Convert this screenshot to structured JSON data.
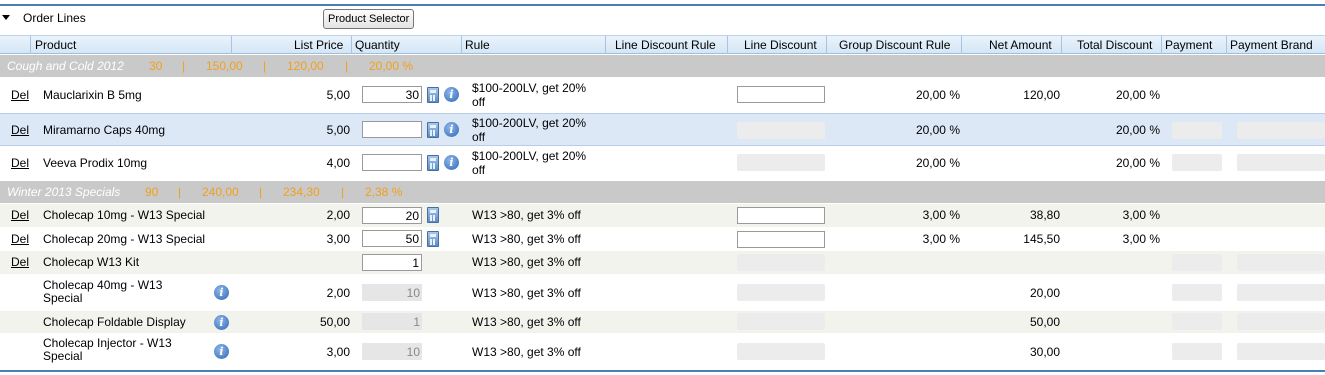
{
  "section": {
    "title": "Order Lines",
    "product_selector_label": "Product Selector"
  },
  "columns": [
    "Product",
    "List Price",
    "Quantity",
    "Rule",
    "Line Discount Rule",
    "Line Discount",
    "Group Discount Rule",
    "Net Amount",
    "Total Discount",
    "Payment",
    "Payment Brand"
  ],
  "groups": [
    {
      "name": "Cough and Cold 2012",
      "qty": "30",
      "amount": "150,00",
      "net": "120,00",
      "disc": "20,00 %"
    },
    {
      "name": "Winter 2013 Specials",
      "qty": "90",
      "amount": "240,00",
      "net": "234,30",
      "disc": "2,38 %"
    }
  ],
  "separator": "|",
  "del_label": "Del",
  "info_glyph": "i",
  "rows": [
    {
      "product": "Mauclarixin B 5mg",
      "price": "5,00",
      "qty": "30",
      "rule": "$100-200LV, get 20% off",
      "group_discount": "20,00 %",
      "net": "120,00",
      "total_discount": "20,00 %"
    },
    {
      "product": "Miramarno Caps 40mg",
      "price": "5,00",
      "qty": "",
      "rule": "$100-200LV, get 20% off",
      "group_discount": "20,00 %",
      "net": "",
      "total_discount": "20,00 %"
    },
    {
      "product": "Veeva Prodix 10mg",
      "price": "4,00",
      "qty": "",
      "rule": "$100-200LV, get 20% off",
      "group_discount": "20,00 %",
      "net": "",
      "total_discount": "20,00 %"
    },
    {
      "product": "Cholecap 10mg - W13 Special",
      "price": "2,00",
      "qty": "20",
      "rule": "W13 >80, get 3% off",
      "group_discount": "3,00 %",
      "net": "38,80",
      "total_discount": "3,00 %"
    },
    {
      "product": "Cholecap 20mg - W13 Special",
      "price": "3,00",
      "qty": "50",
      "rule": "W13 >80, get 3% off",
      "group_discount": "3,00 %",
      "net": "145,50",
      "total_discount": "3,00 %"
    },
    {
      "product": "Cholecap W13 Kit",
      "price": "",
      "qty": "1",
      "rule": "W13 >80, get 3% off",
      "group_discount": "",
      "net": "",
      "total_discount": ""
    },
    {
      "product": "Cholecap 40mg - W13 Special",
      "price": "2,00",
      "qty": "10",
      "rule": "W13 >80, get 3% off",
      "group_discount": "",
      "net": "20,00",
      "total_discount": ""
    },
    {
      "product": "Cholecap Foldable Display",
      "price": "50,00",
      "qty": "1",
      "rule": "W13 >80, get 3% off",
      "group_discount": "",
      "net": "50,00",
      "total_discount": ""
    },
    {
      "product": "Cholecap Injector - W13 Special",
      "price": "3,00",
      "qty": "10",
      "rule": "W13 >80, get 3% off",
      "group_discount": "",
      "net": "30,00",
      "total_discount": ""
    }
  ],
  "colors": {
    "accent": "#4a7fb5",
    "group_bg": "#c9c9c9",
    "group_values": "#f0a020",
    "selected_row": "#dde8f7"
  }
}
